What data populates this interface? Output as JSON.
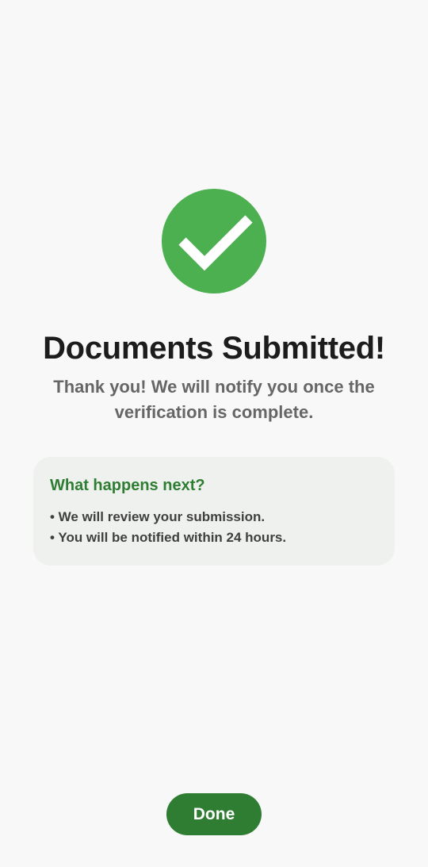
{
  "success": {
    "icon": "checkmark-circle-icon",
    "icon_color": "#4caf50"
  },
  "title": "Documents Submitted!",
  "subtitle": "Thank you! We will notify you once the verification is complete.",
  "next_steps": {
    "heading": "What happens next?",
    "items": [
      "• We will review your submission.",
      "• You will be notified within 24 hours."
    ],
    "heading_color": "#2e7d32",
    "card_background": "#eff1ee"
  },
  "done_button": {
    "label": "Done",
    "color": "#2e7d32"
  }
}
